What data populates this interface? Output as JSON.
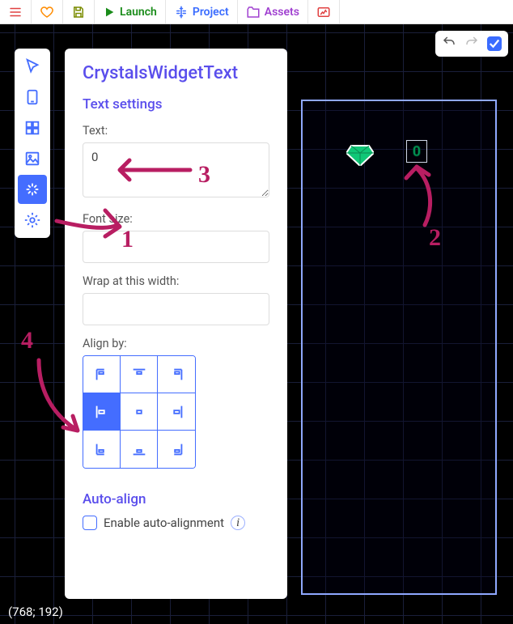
{
  "toolbar": {
    "launch": "Launch",
    "project": "Project",
    "assets": "Assets"
  },
  "panel": {
    "title": "CrystalsWidgetText",
    "section_text": "Text settings",
    "text_label": "Text:",
    "text_value": "0",
    "fontsize_label": "Font size:",
    "fontsize_value": "",
    "wrap_label": "Wrap at this width:",
    "wrap_value": "",
    "align_label": "Align by:",
    "section_auto": "Auto-align",
    "auto_checkbox": "Enable auto-alignment"
  },
  "canvas": {
    "widget_text": "0",
    "coords": "(768; 192)"
  },
  "annotations": {
    "n1": "1",
    "n2": "2",
    "n3": "3",
    "n4": "4"
  }
}
